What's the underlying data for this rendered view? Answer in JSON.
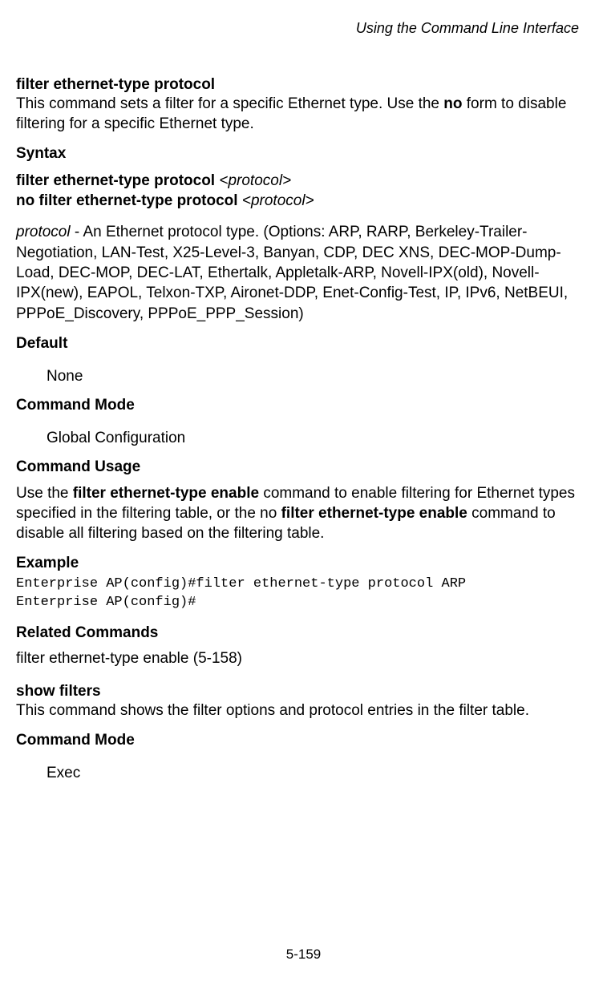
{
  "header": {
    "running_title": "Using the Command Line Interface"
  },
  "cmd1": {
    "name": "filter ethernet-type protocol",
    "desc_pre": "This command sets a filter for a specific Ethernet type. Use the ",
    "desc_bold": "no",
    "desc_post": " form to disable filtering for a specific Ethernet type.",
    "syntax_heading": "Syntax",
    "syntax_line1_bold": "filter ethernet-type protocol ",
    "syntax_line1_ital": "<protocol>",
    "syntax_line2_bold": "no filter ethernet-type protocol ",
    "syntax_line2_ital": "<protocol>",
    "protocol_label": "protocol",
    "protocol_desc": " - An Ethernet protocol type. (Options: ARP, RARP, Berkeley-Trailer-Negotiation, LAN-Test, X25-Level-3, Banyan, CDP, DEC XNS, DEC-MOP-Dump-Load, DEC-MOP, DEC-LAT, Ethertalk, Appletalk-ARP, Novell-IPX(old), Novell-IPX(new), EAPOL, Telxon-TXP, Aironet-DDP, Enet-Config-Test, IP, IPv6, NetBEUI, PPPoE_Discovery, PPPoE_PPP_Session)",
    "default_heading": "Default",
    "default_value": "None",
    "mode_heading": "Command Mode",
    "mode_value": "Global Configuration",
    "usage_heading": "Command Usage",
    "usage_pre": "Use the ",
    "usage_b1": "filter ethernet-type enable",
    "usage_mid": " command to enable filtering for Ethernet types specified in the filtering table, or the no ",
    "usage_b2": "filter ethernet-type enable",
    "usage_post": " command to disable all filtering based on the filtering table.",
    "example_heading": "Example",
    "example_code": "Enterprise AP(config)#filter ethernet-type protocol ARP\nEnterprise AP(config)#",
    "related_heading": "Related Commands",
    "related_value": "filter ethernet-type enable (5-158)"
  },
  "cmd2": {
    "name": "show filters",
    "desc": "This command shows the filter options and protocol entries in the filter table.",
    "mode_heading": "Command Mode",
    "mode_value": "Exec"
  },
  "footer": {
    "page_number": "5-159"
  }
}
